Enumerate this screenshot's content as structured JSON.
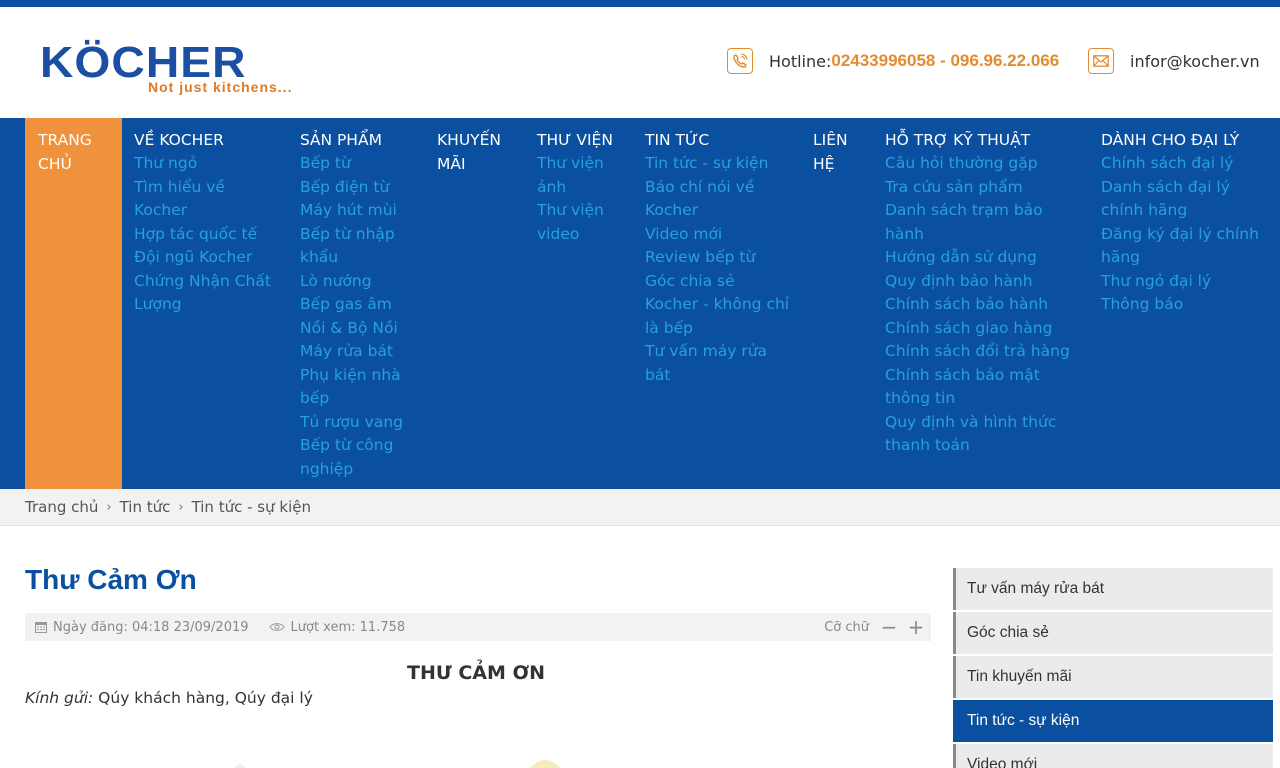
{
  "header": {
    "logo_text": "KÖCHER",
    "logo_tagline": "Not just kitchens...",
    "hotline_label": "Hotline: ",
    "hotline_numbers": "02433996058 - 096.96.22.066",
    "email": "infor@kocher.vn",
    "accent_color": "#e58b2f",
    "brand_color": "#0a4fa0"
  },
  "nav": {
    "home": "TRANG CHỦ",
    "about": {
      "label": "VỀ KOCHER",
      "items": [
        "Thư ngỏ",
        "Tìm hiểu về Kocher",
        "Hợp tác quốc tế",
        "Đội ngũ Kocher",
        "Chứng Nhận Chất Lượng"
      ]
    },
    "products": {
      "label": "SẢN PHẨM",
      "items": [
        "Bếp từ",
        "Bếp điện từ",
        "Máy hút mùi",
        "Bếp từ nhập khẩu",
        "Lò nướng",
        "Bếp gas âm",
        "Nồi & Bộ Nồi",
        "Máy rửa bát",
        "Phụ kiện nhà bếp",
        "Tủ rượu vang",
        "Bếp từ công nghiệp"
      ]
    },
    "promo": {
      "label": "KHUYẾN MÃI"
    },
    "library": {
      "label": "THƯ VIỆN",
      "items": [
        "Thư viện ảnh",
        "Thư viện video"
      ]
    },
    "news": {
      "label": "TIN TỨC",
      "items": [
        "Tin tức - sự kiện",
        "Báo chí nói về Kocher",
        "Video mới",
        "Review bếp từ",
        "Góc chia sẻ",
        "Kocher - không chỉ là bếp",
        "Tư vấn máy rửa bát"
      ]
    },
    "contact": {
      "label": "LIÊN HỆ"
    },
    "support": {
      "label": "HỖ TRỢ KỸ THUẬT",
      "items": [
        "Câu hỏi thường gặp",
        "Tra cứu sản phẩm",
        "Danh sách trạm bảo hành",
        "Hướng dẫn sử dụng",
        "Quy định bảo hành",
        "Chính sách bảo hành",
        "Chính sách giao hàng",
        "Chính sách đổi trả hàng",
        "Chính sách bảo mật thông tin",
        "Quy định và hình thức thanh toán"
      ]
    },
    "dealer": {
      "label": "DÀNH CHO ĐẠI LÝ",
      "items": [
        "Chính sách đại lý",
        "Danh sách đại lý chính hãng",
        "Đăng ký đại lý chính hãng",
        "Thư ngỏ đại lý",
        "Thông báo"
      ]
    }
  },
  "breadcrumb": [
    "Trang chủ",
    "Tin tức",
    "Tin tức - sự kiện"
  ],
  "breadcrumb_sep": "›",
  "article": {
    "title": "Thư Cảm Ơn",
    "date": "Ngày đăng: 04:18 23/09/2019",
    "views": "Lượt xem: 11.758",
    "font_size_label": "Cỡ chữ",
    "font_minus": "−",
    "font_plus": "+",
    "heading": "THƯ CẢM ƠN",
    "greeting_label": "Kính gửi:",
    "greeting_text": " Qúy khách hàng, Qúy đại lý"
  },
  "sidebar": {
    "items": [
      {
        "label": "Tư vấn máy rửa bát",
        "active": false
      },
      {
        "label": "Góc chia sẻ",
        "active": false
      },
      {
        "label": "Tin khuyến mãi",
        "active": false
      },
      {
        "label": "Tin tức - sự kiện",
        "active": true
      },
      {
        "label": "Video mới",
        "active": false
      }
    ]
  }
}
